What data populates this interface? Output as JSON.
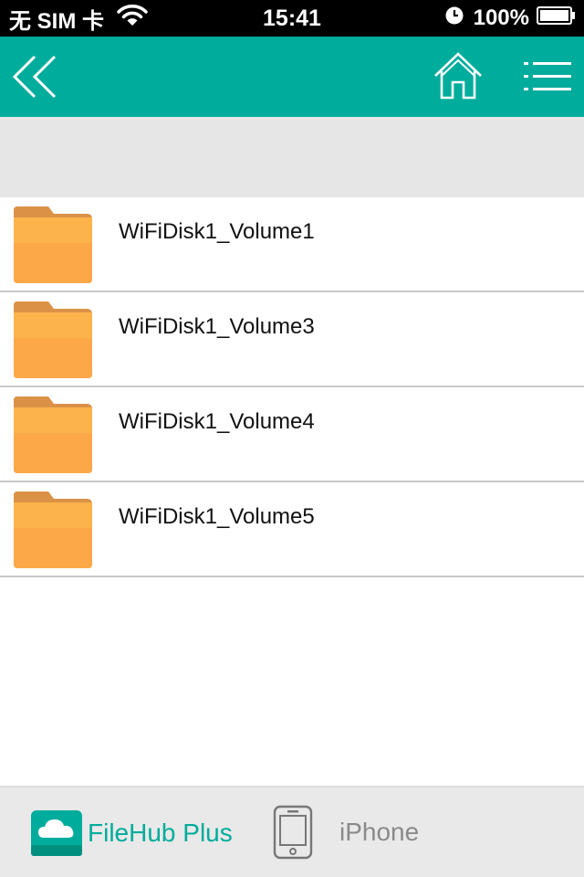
{
  "status_bar": {
    "carrier": "无 SIM 卡",
    "time": "15:41",
    "battery": "100%"
  },
  "nav": {
    "back_icon": "double-chevron-left-icon",
    "home_icon": "home-icon",
    "menu_icon": "menu-list-icon",
    "accent": "#00ac9c"
  },
  "list": {
    "items": [
      {
        "name": "WiFiDisk1_Volume1",
        "icon": "folder-icon"
      },
      {
        "name": "WiFiDisk1_Volume3",
        "icon": "folder-icon"
      },
      {
        "name": "WiFiDisk1_Volume4",
        "icon": "folder-icon"
      },
      {
        "name": "WiFiDisk1_Volume5",
        "icon": "folder-icon"
      }
    ]
  },
  "tabbar": {
    "filehub_label": "FileHub Plus",
    "iphone_label": "iPhone",
    "active_color": "#00ac9c",
    "inactive_color": "#8a8a8a"
  }
}
